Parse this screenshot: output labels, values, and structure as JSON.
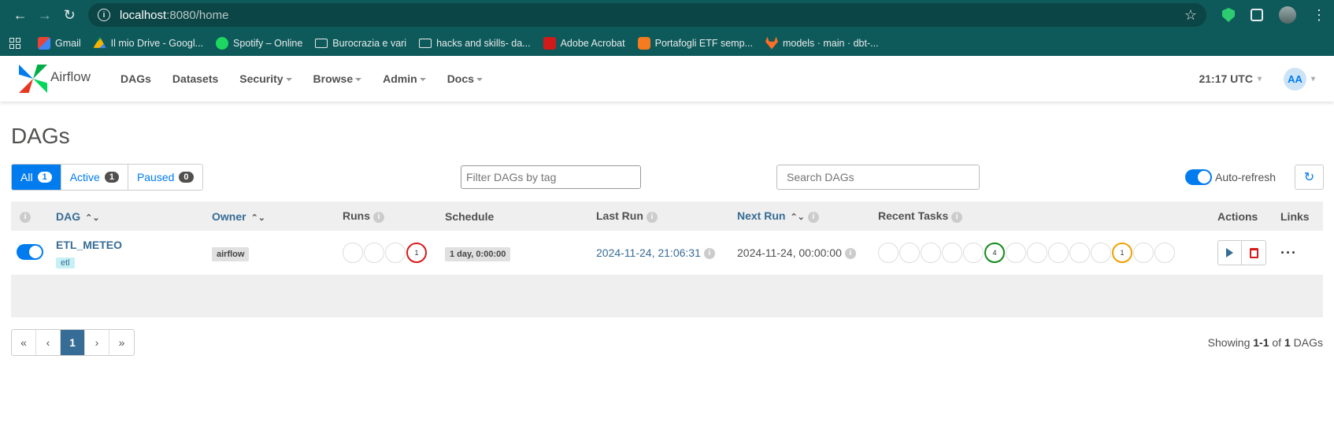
{
  "browser": {
    "url_host": "localhost",
    "url_path": ":8080/home",
    "bookmarks": [
      {
        "label": "Gmail",
        "icon": "gmail-icon"
      },
      {
        "label": "Il mio Drive - Googl...",
        "icon": "drive-icon"
      },
      {
        "label": "Spotify – Online",
        "icon": "spotify-icon"
      },
      {
        "label": "Burocrazia e vari",
        "icon": "folder-icon"
      },
      {
        "label": "hacks and skills- da...",
        "icon": "folder-icon"
      },
      {
        "label": "Adobe Acrobat",
        "icon": "acrobat-icon"
      },
      {
        "label": "Portafogli ETF semp...",
        "icon": "portfolio-icon"
      },
      {
        "label": "models · main · dbt-...",
        "icon": "gitlab-icon"
      }
    ]
  },
  "navbar": {
    "brand": "Airflow",
    "menu": [
      "DAGs",
      "Datasets",
      "Security",
      "Browse",
      "Admin",
      "Docs"
    ],
    "time": "21:17 UTC",
    "avatar": "AA"
  },
  "page": {
    "title": "DAGs",
    "tabs": [
      {
        "label": "All",
        "count": "1"
      },
      {
        "label": "Active",
        "count": "1"
      },
      {
        "label": "Paused",
        "count": "0"
      }
    ],
    "tag_filter_placeholder": "Filter DAGs by tag",
    "search_placeholder": "Search DAGs",
    "auto_refresh_label": "Auto-refresh"
  },
  "table": {
    "headers": {
      "dag": "DAG",
      "owner": "Owner",
      "runs": "Runs",
      "schedule": "Schedule",
      "last_run": "Last Run",
      "next_run": "Next Run",
      "recent_tasks": "Recent Tasks",
      "actions": "Actions",
      "links": "Links"
    },
    "row": {
      "dag_id": "ETL_METEO",
      "tag": "etl",
      "owner": "airflow",
      "runs_failed": "1",
      "schedule": "1 day, 0:00:00",
      "last_run": "2024-11-24, 21:06:31",
      "next_run": "2024-11-24, 00:00:00",
      "recent_success": "4",
      "recent_up_for_retry": "1"
    }
  },
  "pagination": {
    "first": "«",
    "prev": "‹",
    "current": "1",
    "next": "›",
    "last": "»",
    "showing_prefix": "Showing ",
    "showing_range": "1-1",
    "showing_of": " of ",
    "showing_total": "1",
    "showing_suffix": " DAGs"
  }
}
